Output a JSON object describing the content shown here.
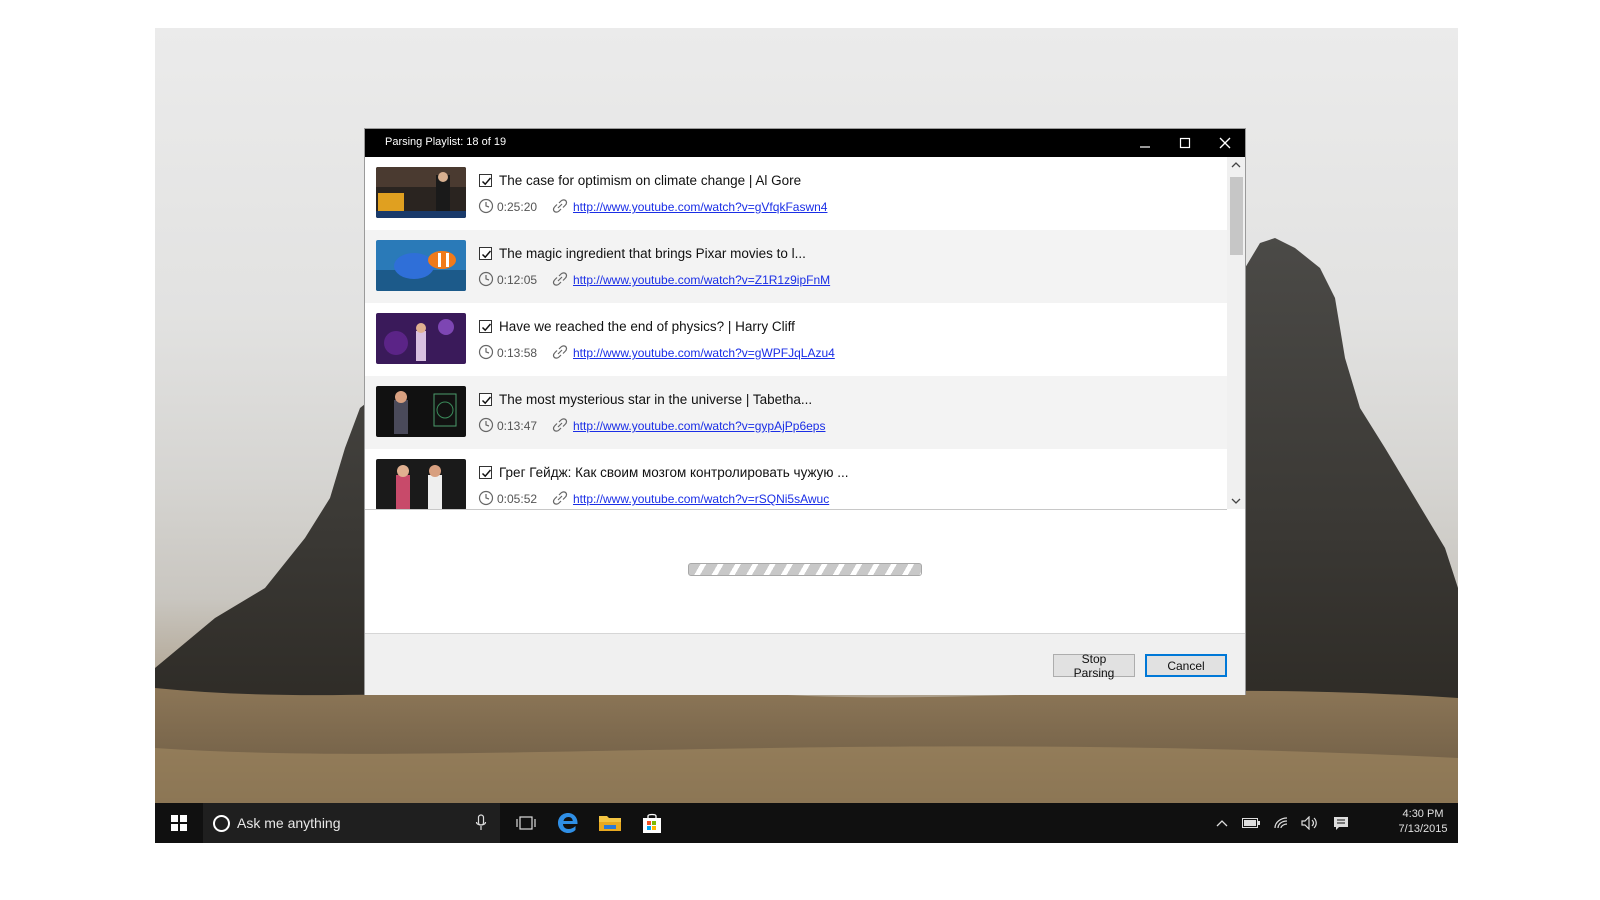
{
  "dialog": {
    "title": "Parsing Playlist: 18 of 19",
    "items": [
      {
        "title": "The case for optimism on climate change | Al Gore",
        "duration": "0:25:20",
        "url": "http://www.youtube.com/watch?v=gVfqkFaswn4",
        "checked": true
      },
      {
        "title": "The magic ingredient that brings Pixar movies to l...",
        "duration": "0:12:05",
        "url": "http://www.youtube.com/watch?v=Z1R1z9ipFnM",
        "checked": true
      },
      {
        "title": "Have we reached the end of physics? | Harry Cliff",
        "duration": "0:13:58",
        "url": "http://www.youtube.com/watch?v=gWPFJqLAzu4",
        "checked": true
      },
      {
        "title": "The most mysterious star in the universe | Tabetha...",
        "duration": "0:13:47",
        "url": "http://www.youtube.com/watch?v=gypAjPp6eps",
        "checked": true
      },
      {
        "title": "Грег Гейдж: Как своим мозгом контролировать чужую ...",
        "duration": "0:05:52",
        "url": "http://www.youtube.com/watch?v=rSQNi5sAwuc",
        "checked": true
      }
    ],
    "buttons": {
      "stop": "Stop Parsing",
      "cancel": "Cancel"
    },
    "accent_color": "#0078d7",
    "link_color": "#1a2ee6"
  },
  "taskbar": {
    "search_text": "Ask me anything",
    "time": "4:30 PM",
    "date": "7/13/2015",
    "icons": [
      "windows-start-icon",
      "cortana-circle-icon",
      "microphone-icon",
      "task-view-icon",
      "edge-icon",
      "file-explorer-icon",
      "store-icon",
      "chevron-up-icon",
      "battery-icon",
      "wifi-icon",
      "volume-icon",
      "action-center-icon"
    ]
  }
}
